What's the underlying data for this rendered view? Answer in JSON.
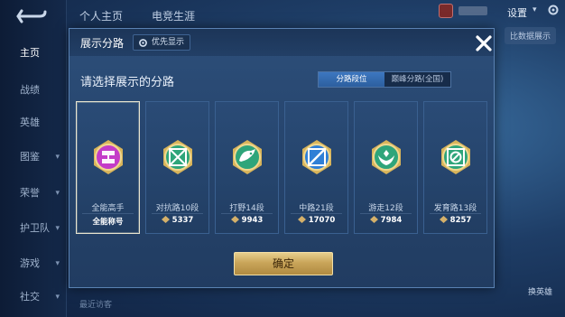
{
  "background": {
    "sidebar": [
      {
        "label": "主页",
        "active": true
      },
      {
        "label": "战绩",
        "chevron": false
      },
      {
        "label": "英雄",
        "chevron": false
      },
      {
        "label": "图鉴",
        "chevron": true
      },
      {
        "label": "荣誉",
        "chevron": true
      },
      {
        "label": "护卫队",
        "chevron": true
      },
      {
        "label": "游戏",
        "chevron": true
      },
      {
        "label": "社交",
        "chevron": true
      }
    ],
    "top_tabs": [
      "个人主页",
      "电竞生涯"
    ],
    "settings_label": "设置",
    "compare_label": "比数据展示",
    "swap_hero_label": "换英雄",
    "recent_hint": "最近访客"
  },
  "modal": {
    "title": "展示分路",
    "priority_label": "优先显示",
    "prompt": "请选择展示的分路",
    "toggle": [
      {
        "label": "分路段位",
        "active": true
      },
      {
        "label": "巅峰分路(全国)",
        "active": false
      }
    ],
    "cards": [
      {
        "name": "全能高手",
        "sub": "全能称号",
        "score": null,
        "selected": true,
        "emblem": "all-round-emblem-icon",
        "color": "#c43cc8"
      },
      {
        "name": "对抗路10段",
        "sub": null,
        "score": "5337",
        "selected": false,
        "emblem": "clash-lane-emblem-icon",
        "color": "#2fa57a"
      },
      {
        "name": "打野14段",
        "sub": null,
        "score": "9943",
        "selected": false,
        "emblem": "jungle-emblem-icon",
        "color": "#2fa57a"
      },
      {
        "name": "中路21段",
        "sub": null,
        "score": "17070",
        "selected": false,
        "emblem": "mid-lane-emblem-icon",
        "color": "#2f7fd6"
      },
      {
        "name": "游走12段",
        "sub": null,
        "score": "7984",
        "selected": false,
        "emblem": "roam-emblem-icon",
        "color": "#2fa57a"
      },
      {
        "name": "发育路13段",
        "sub": null,
        "score": "8257",
        "selected": false,
        "emblem": "farm-lane-emblem-icon",
        "color": "#2fa57a"
      }
    ],
    "confirm_label": "确定"
  },
  "colors": {
    "accent_gold": "#d4b06a",
    "accent_blue": "#3d77c0",
    "selected_emblem": "#c43cc8",
    "lane_emblem": "#2fa57a"
  }
}
